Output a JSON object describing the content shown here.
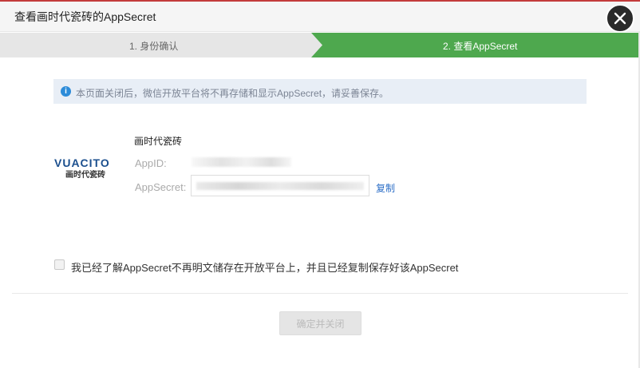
{
  "dialog": {
    "title": "查看画时代瓷砖的AppSecret",
    "close_icon": "close-icon"
  },
  "steps": [
    {
      "label": "1. 身份确认",
      "state": "done"
    },
    {
      "label": "2. 查看AppSecret",
      "state": "active"
    }
  ],
  "colors": {
    "active_step": "#4ea84e",
    "inactive_step": "#e6e6e6",
    "link": "#2d6fc7",
    "info_icon": "#2d8cd9"
  },
  "notice": {
    "icon": "info-icon",
    "icon_glyph": "i",
    "text": "本页面关闭后，微信开放平台将不再存储和显示AppSecret，请妥善保存。"
  },
  "app": {
    "logo_en": "VUACITO",
    "logo_cn": "画时代瓷砖",
    "name": "画时代瓷砖",
    "appid_label": "AppID:",
    "appsecret_label": "AppSecret:",
    "copy_label": "复制"
  },
  "confirm": {
    "checkbox_label": "我已经了解AppSecret不再明文储存在开放平台上，并且已经复制保存好该AppSecret",
    "button_label": "确定并关闭"
  }
}
